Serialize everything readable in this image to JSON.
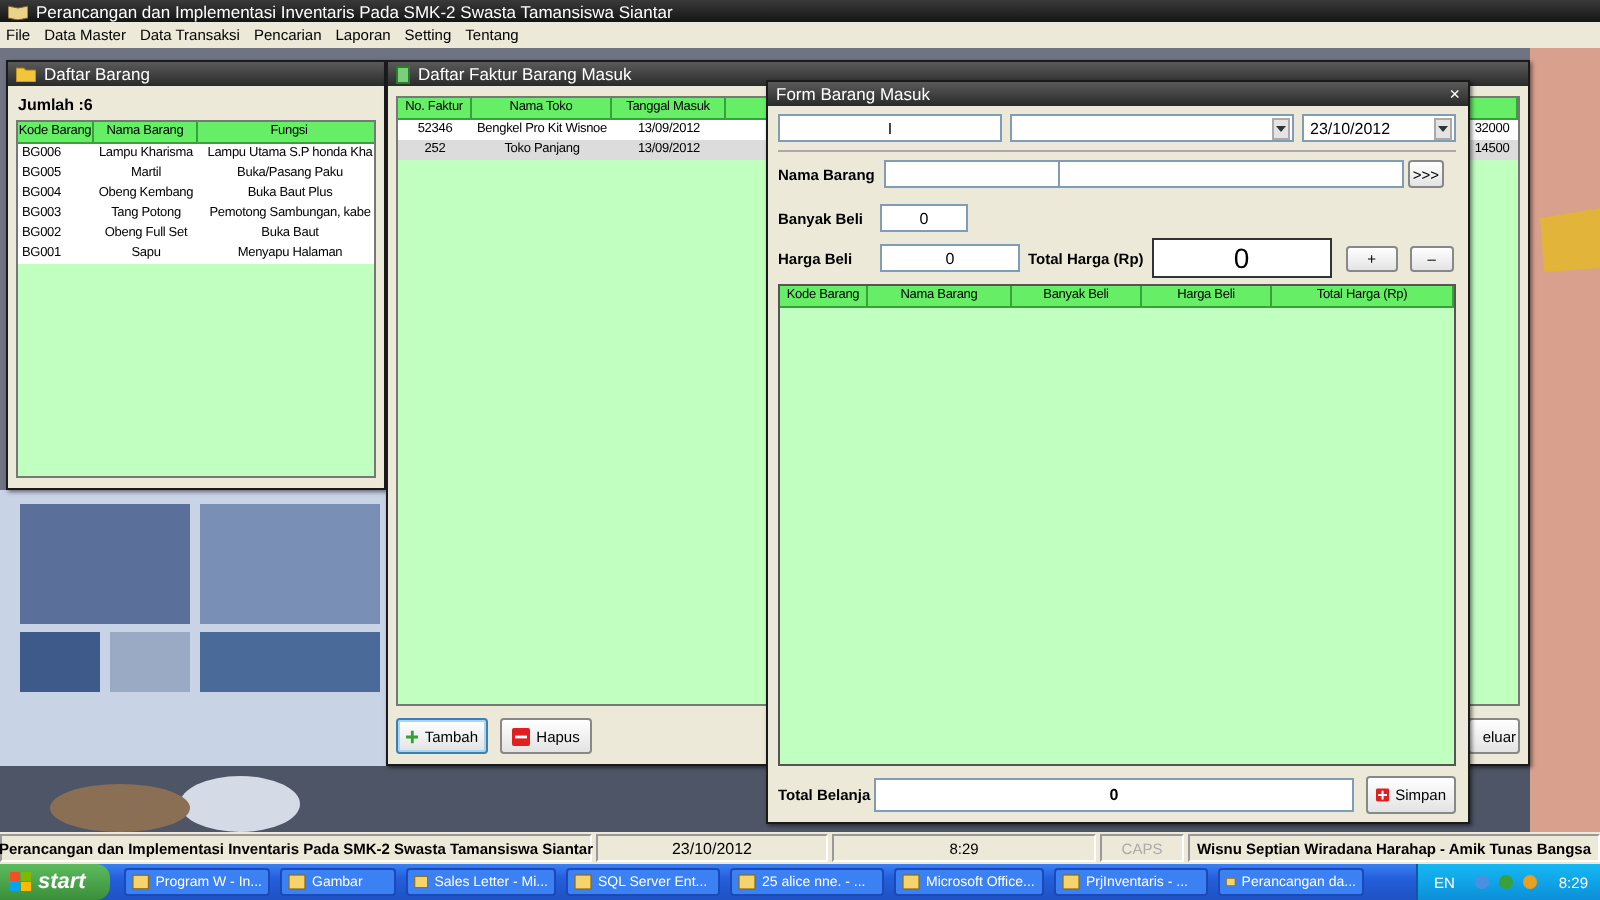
{
  "app": {
    "title": "Perancangan dan Implementasi Inventaris Pada SMK-2 Swasta Tamansiswa Siantar"
  },
  "menu": [
    "File",
    "Data Master",
    "Data Transaksi",
    "Pencarian",
    "Laporan",
    "Setting",
    "Tentang"
  ],
  "daftar_barang": {
    "title": "Daftar Barang",
    "count": "Jumlah :6",
    "columns": [
      "Kode Barang",
      "Nama Barang",
      "Fungsi"
    ],
    "rows": [
      [
        "BG006",
        "Lampu Kharisma",
        "Lampu Utama S.P honda Kha"
      ],
      [
        "BG005",
        "Martil",
        "Buka/Pasang Paku"
      ],
      [
        "BG004",
        "Obeng Kembang",
        "Buka Baut Plus"
      ],
      [
        "BG003",
        "Tang Potong",
        "Pemotong Sambungan, kabe"
      ],
      [
        "BG002",
        "Obeng Full Set",
        "Buka Baut"
      ],
      [
        "BG001",
        "Sapu",
        "Menyapu Halaman"
      ]
    ]
  },
  "daftar_faktur": {
    "title": "Daftar Faktur Barang Masuk",
    "columns": [
      "No. Faktur",
      "Nama Toko",
      "Tanggal Masuk"
    ],
    "rows": [
      {
        "cells": [
          "52346",
          "Bengkel Pro Kit Wisnoe",
          "13/09/2012"
        ],
        "column_5": "32000",
        "selected": false
      },
      {
        "cells": [
          "252",
          "Toko Panjang",
          "13/09/2012"
        ],
        "column_5": "14500",
        "selected": true
      }
    ],
    "buttons": [
      {
        "label": "Tambah",
        "kind": "add",
        "focused": true
      },
      {
        "label": "Hapus",
        "kind": "delete",
        "focused": false
      },
      {
        "label": "eluar",
        "kind": "plain",
        "focused": false
      }
    ]
  },
  "form_barang_masuk": {
    "title": "Form Barang Masuk",
    "close": "×",
    "invoice": {
      "value": "I"
    },
    "date": {
      "value": "23/10/2012"
    },
    "nama_barang": {
      "label": "Nama Barang"
    },
    "browse_button": ">>>",
    "banyak_beli": {
      "label": "Banyak Beli",
      "value": "0"
    },
    "harga_beli": {
      "label": "Harga Beli",
      "value": "0"
    },
    "total_harga": {
      "label": "Total Harga (Rp)",
      "value": "0"
    },
    "add_button": "+",
    "remove_button": "–",
    "columns": [
      "Kode Barang",
      "Nama Barang",
      "Banyak Beli",
      "Harga Beli",
      "Total Harga (Rp)"
    ],
    "total_belanja": {
      "label": "Total Belanja",
      "value": "0"
    },
    "save_button": {
      "label": "Simpan",
      "kind": "save"
    }
  },
  "status_bar": [
    {
      "text": "Perancangan dan Implementasi Inventaris Pada SMK-2 Swasta Tamansiswa Siantar",
      "disabled": false
    },
    {
      "text": "23/10/2012",
      "disabled": false
    },
    {
      "text": "8:29",
      "disabled": false
    },
    {
      "text": "CAPS",
      "disabled": true
    },
    {
      "text": "Wisnu Septian Wiradana Harahap - Amik Tunas Bangsa",
      "disabled": false
    }
  ],
  "taskbar": {
    "start": "start",
    "buttons": [
      "Program W - In...",
      "Gambar",
      "Sales Letter - Mi...",
      "SQL Server Ent...",
      "25 alice nne. - ...",
      "Microsoft Office...",
      "PrjInventaris - ...",
      "Perancangan da..."
    ],
    "language": "EN",
    "clock": "8:29"
  }
}
